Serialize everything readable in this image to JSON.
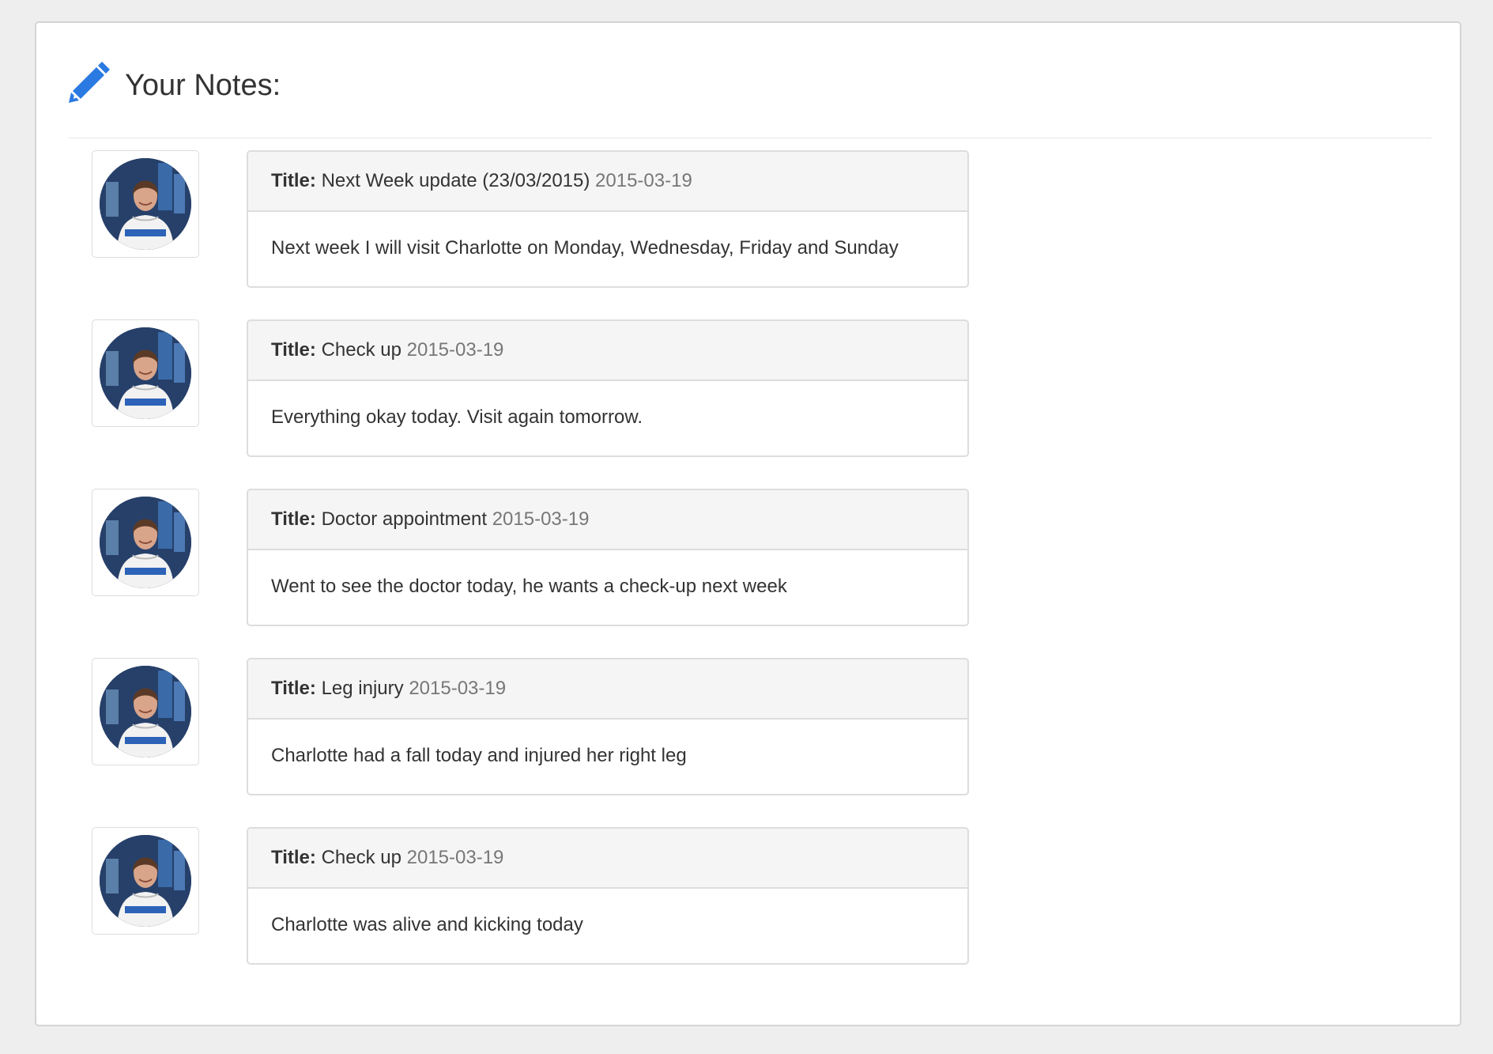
{
  "header": {
    "title": "Your Notes:",
    "icon": "pencil-icon",
    "icon_color": "#2a7ae2"
  },
  "notes": [
    {
      "title_label": "Title:",
      "title": "Next Week update (23/03/2015)",
      "date": "2015-03-19",
      "body": "Next week I will visit Charlotte on Monday, Wednesday, Friday and Sunday",
      "avatar": "author-avatar"
    },
    {
      "title_label": "Title:",
      "title": "Check up",
      "date": "2015-03-19",
      "body": "Everything okay today. Visit again tomorrow.",
      "avatar": "author-avatar"
    },
    {
      "title_label": "Title:",
      "title": "Doctor appointment",
      "date": "2015-03-19",
      "body": "Went to see the doctor today, he wants a check-up next week",
      "avatar": "author-avatar"
    },
    {
      "title_label": "Title:",
      "title": "Leg injury",
      "date": "2015-03-19",
      "body": "Charlotte had a fall today and injured her right leg",
      "avatar": "author-avatar"
    },
    {
      "title_label": "Title:",
      "title": "Check up",
      "date": "2015-03-19",
      "body": "Charlotte was alive and kicking today",
      "avatar": "author-avatar"
    }
  ]
}
